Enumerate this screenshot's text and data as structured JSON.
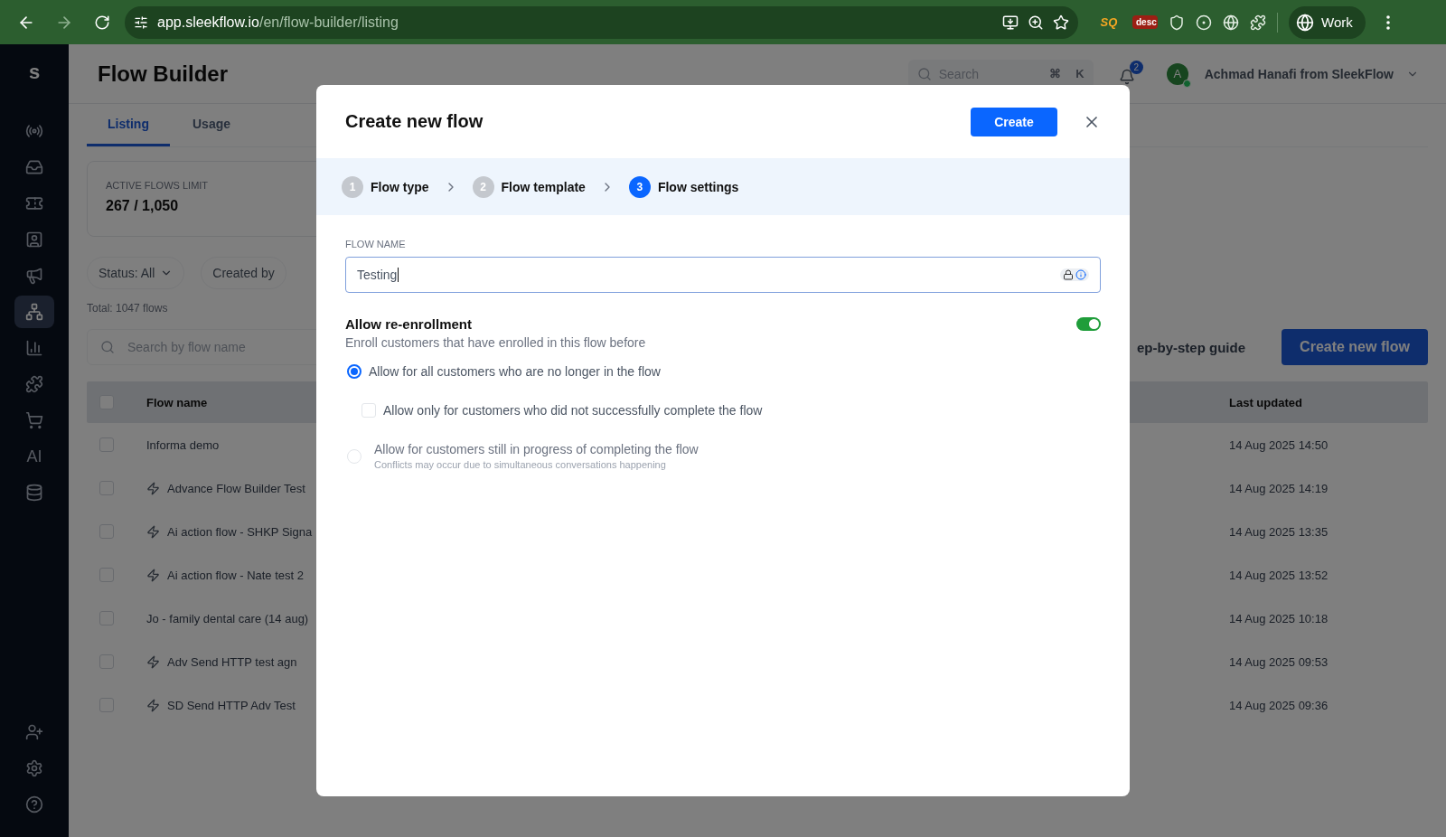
{
  "browser": {
    "url_host": "app.sleekflow.io",
    "url_path": "/en/flow-builder/listing",
    "extension_badges": [
      "SQ",
      "desc"
    ],
    "profile": "Work"
  },
  "sidebar": {
    "logo": "s",
    "items": [
      {
        "selected": false
      },
      {
        "selected": false
      },
      {
        "selected": false
      },
      {
        "selected": false
      },
      {
        "selected": false
      },
      {
        "selected": true
      },
      {
        "selected": false
      },
      {
        "selected": false
      },
      {
        "selected": false
      },
      {
        "selected": false,
        "label": "AI"
      },
      {
        "selected": false
      }
    ],
    "bottom_items": [
      {
        "selected": false
      },
      {
        "selected": false
      },
      {
        "selected": false
      }
    ]
  },
  "header": {
    "title": "Flow Builder",
    "search_placeholder": "Search",
    "shortcut_keys": [
      "⌘",
      "K"
    ],
    "notification_count": "2",
    "avatar_initial": "A",
    "user_name": "Achmad Hanafi from SleekFlow"
  },
  "tabs": [
    {
      "label": "Listing",
      "selected": true
    },
    {
      "label": "Usage",
      "selected": false
    }
  ],
  "limit_card": {
    "label": "ACTIVE FLOWS LIMIT",
    "value": "267 / 1,050"
  },
  "filters": [
    {
      "label": "Status: All",
      "has_caret": true
    },
    {
      "label": "Created by",
      "has_caret": false
    }
  ],
  "total": "Total: 1047 flows",
  "search": {
    "placeholder": "Search by flow name"
  },
  "guide_link": "ep-by-step guide",
  "create_button": "Create new flow",
  "table": {
    "columns": [
      "Flow name",
      "Last updated"
    ],
    "header_checked": false,
    "rows": [
      {
        "kind": "standard",
        "name": "Informa demo",
        "updated": "14 Aug 2025 14:50",
        "checked": false
      },
      {
        "kind": "advanced",
        "name": "Advance Flow Builder Test",
        "updated": "14 Aug 2025 14:19",
        "checked": false
      },
      {
        "kind": "advanced",
        "name": "Ai action flow - SHKP Signa",
        "updated": "14 Aug 2025 13:35",
        "checked": false
      },
      {
        "kind": "advanced",
        "name": "Ai action flow - Nate test 2",
        "updated": "14 Aug 2025 13:52",
        "checked": false
      },
      {
        "kind": "standard",
        "name": "Jo - family dental care (14 aug)",
        "updated": "14 Aug 2025 10:18",
        "checked": false
      },
      {
        "kind": "advanced",
        "name": "Adv Send HTTP test agn",
        "updated": "14 Aug 2025 09:53",
        "checked": false
      },
      {
        "kind": "advanced",
        "name": "SD Send HTTP Adv Test",
        "updated": "14 Aug 2025 09:36",
        "checked": false
      }
    ]
  },
  "modal": {
    "title": "Create new flow",
    "create_button": "Create",
    "steps": [
      {
        "number": "1",
        "label": "Flow type",
        "selected": false
      },
      {
        "number": "2",
        "label": "Flow template",
        "selected": false
      },
      {
        "number": "3",
        "label": "Flow settings",
        "selected": true
      }
    ],
    "field": {
      "label": "FLOW NAME",
      "value": "Testing"
    },
    "reenroll": {
      "title": "Allow re-enrollment",
      "description": "Enroll customers that have enrolled in this flow before",
      "on": true,
      "options": [
        {
          "kind": "radio",
          "label": "Allow for all customers who are no longer in the flow",
          "selected": true,
          "disabled": false
        },
        {
          "kind": "checkbox",
          "label": "Allow only for customers who did not successfully complete the flow",
          "checked": false,
          "disabled": false
        },
        {
          "kind": "radio",
          "label": "Allow for customers still in progress of completing the flow",
          "hint": "Conflicts may occur due to simultaneous conversations happening",
          "selected": false,
          "disabled": true
        }
      ]
    }
  }
}
